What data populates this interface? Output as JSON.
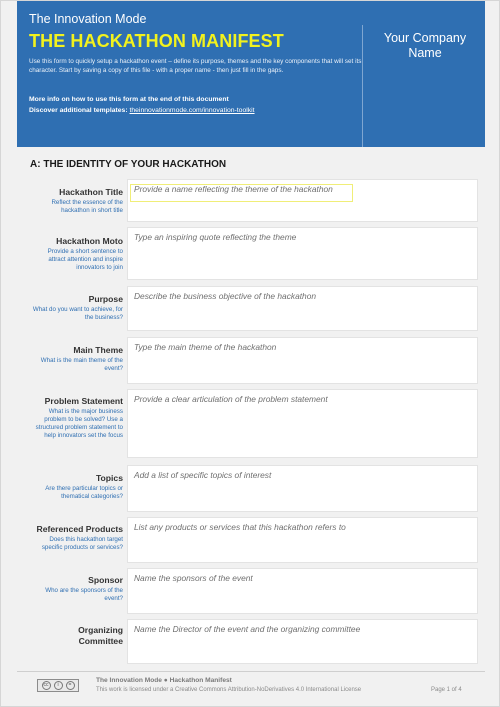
{
  "header": {
    "brand": "The Innovation Mode",
    "title": "THE HACKATHON MANIFEST",
    "description": "Use this form to quickly setup a hackathon event – define its purpose, themes and the key components that will set its character. Start by saving a copy of this file - with a proper name - then just fill in the gaps.",
    "more_info": "More info on how to use this form at the end of this document",
    "discover_label": "Discover additional templates:",
    "discover_link": "theinnovationmode.com/innovation-toolkit",
    "company_name": "Your Company Name"
  },
  "section": {
    "title": "A: THE IDENTITY OF YOUR HACKATHON",
    "rows": [
      {
        "label": "Hackathon Title",
        "hint": "Reflect the essence of the hackathon in short title",
        "placeholder": "Provide a name reflecting the theme of the hackathon"
      },
      {
        "label": "Hackathon Moto",
        "hint": "Provide a short sentence to attract attention and inspire innovators to join",
        "placeholder": "Type an inspiring quote reflecting the theme"
      },
      {
        "label": "Purpose",
        "hint": "What do you want to achieve, for the business?",
        "placeholder": "Describe the business objective of the hackathon"
      },
      {
        "label": "Main Theme",
        "hint": "What is the main theme of the event?",
        "placeholder": "Type the main theme of the hackathon"
      },
      {
        "label": "Problem Statement",
        "hint": "What is the major business problem to be solved? Use a structured problem statement to help innovators set the focus",
        "placeholder": "Provide a clear articulation of the problem statement"
      },
      {
        "label": "Topics",
        "hint": "Are there particular topics or thematical categories?",
        "placeholder": "Add a list of specific topics of interest"
      },
      {
        "label": "Referenced Products",
        "hint": "Does this hackathon target specific products or services?",
        "placeholder": "List any products or services that this hackathon refers to"
      },
      {
        "label": "Sponsor",
        "hint": "Who are the sponsors of the event?",
        "placeholder": "Name the sponsors of the event"
      },
      {
        "label": "Organizing Committee",
        "hint": "",
        "placeholder": "Name the Director of the event and the organizing committee"
      }
    ]
  },
  "footer": {
    "title": "The Innovation Mode ● Hackathon Manifest",
    "license": "This work is licensed under a Creative Commons Attribution-NoDerivatives 4.0 International License",
    "page": "Page 1 of 4",
    "cc_icons": [
      "cc-icon",
      "by-icon",
      "nd-icon"
    ]
  },
  "colors": {
    "header_blue": "#2f6fb2",
    "title_yellow": "#f2f21d",
    "hint_blue": "#2f6fb2"
  }
}
